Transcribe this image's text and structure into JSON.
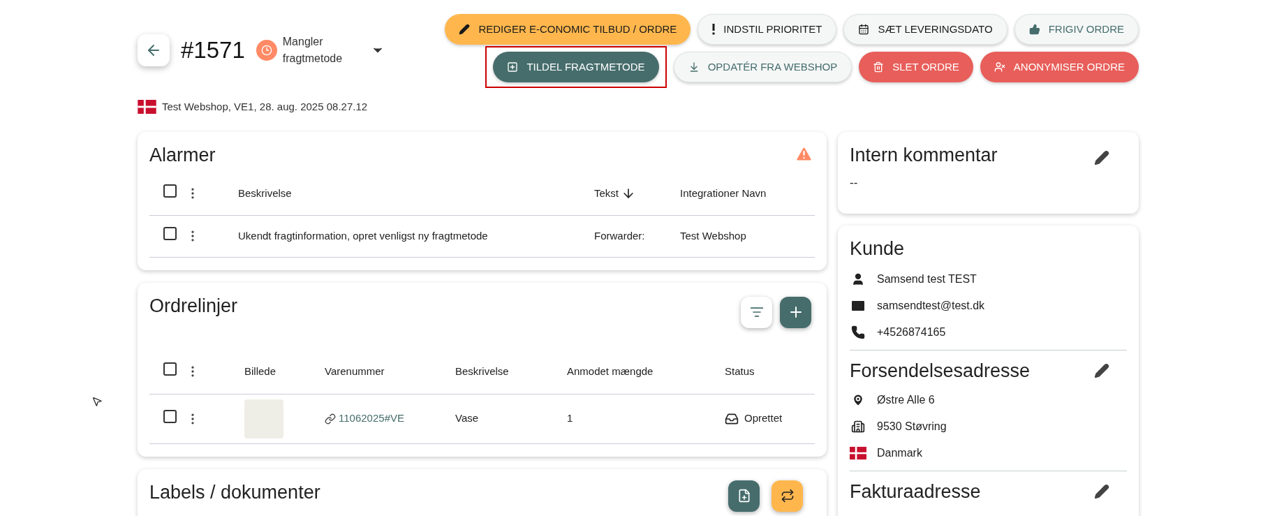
{
  "header": {
    "order_number": "#1571",
    "status": {
      "label": "Mangler fragtmetode"
    },
    "meta": "Test Webshop, VE1, 28. aug. 2025 08.27.12"
  },
  "actions": [
    [
      {
        "label": "REDIGER E-CONOMIC TILBUD / ORDRE",
        "kind": "warning"
      },
      {
        "label": "INDSTIL PRIORITET",
        "kind": "default"
      },
      {
        "label": "SÆT LEVERINGSDATO",
        "kind": "default"
      },
      {
        "label": "FRIGIV ORDRE",
        "kind": "muted"
      }
    ],
    [
      {
        "label": "TILDEL FRAGTMETODE",
        "kind": "primary",
        "highlighted": true
      },
      {
        "label": "OPDATÉR FRA WEBSHOP",
        "kind": "muted"
      },
      {
        "label": "SLET ORDRE",
        "kind": "danger"
      },
      {
        "label": "ANONYMISER ORDRE",
        "kind": "danger"
      }
    ]
  ],
  "alarms": {
    "title": "Alarmer",
    "all_checked": false,
    "columns": [
      {
        "label": "Beskrivelse",
        "sorted": false
      },
      {
        "label": "Tekst",
        "sorted": true
      },
      {
        "label": "Integrationer Navn",
        "sorted": false
      }
    ],
    "rows": [
      {
        "checked": false,
        "cells": [
          "Ukendt fragtinformation, opret venligst ny fragtmetode",
          "Forwarder:",
          "Test Webshop"
        ]
      }
    ]
  },
  "order_lines": {
    "title": "Ordrelinjer",
    "all_checked": false,
    "columns": [
      "Billede",
      "Varenummer",
      "Beskrivelse",
      "Anmodet mængde",
      "Status"
    ],
    "rows": [
      {
        "checked": false,
        "item_number": "11062025#VE",
        "description": "Vase",
        "quantity": "1",
        "status": "Oprettet"
      }
    ]
  },
  "documents": {
    "title": "Labels / dokumenter"
  },
  "internal_comment": {
    "title": "Intern kommentar",
    "value": "--"
  },
  "customer": {
    "title": "Kunde",
    "name": "Samsend test TEST",
    "email": "samsendtest@test.dk",
    "phone": "+4526874165"
  },
  "shipping_address": {
    "title": "Forsendelsesadresse",
    "street": "Østre Alle 6",
    "city": "9530 Støvring",
    "country": "Danmark"
  },
  "billing_address": {
    "title": "Fakturaadresse"
  }
}
